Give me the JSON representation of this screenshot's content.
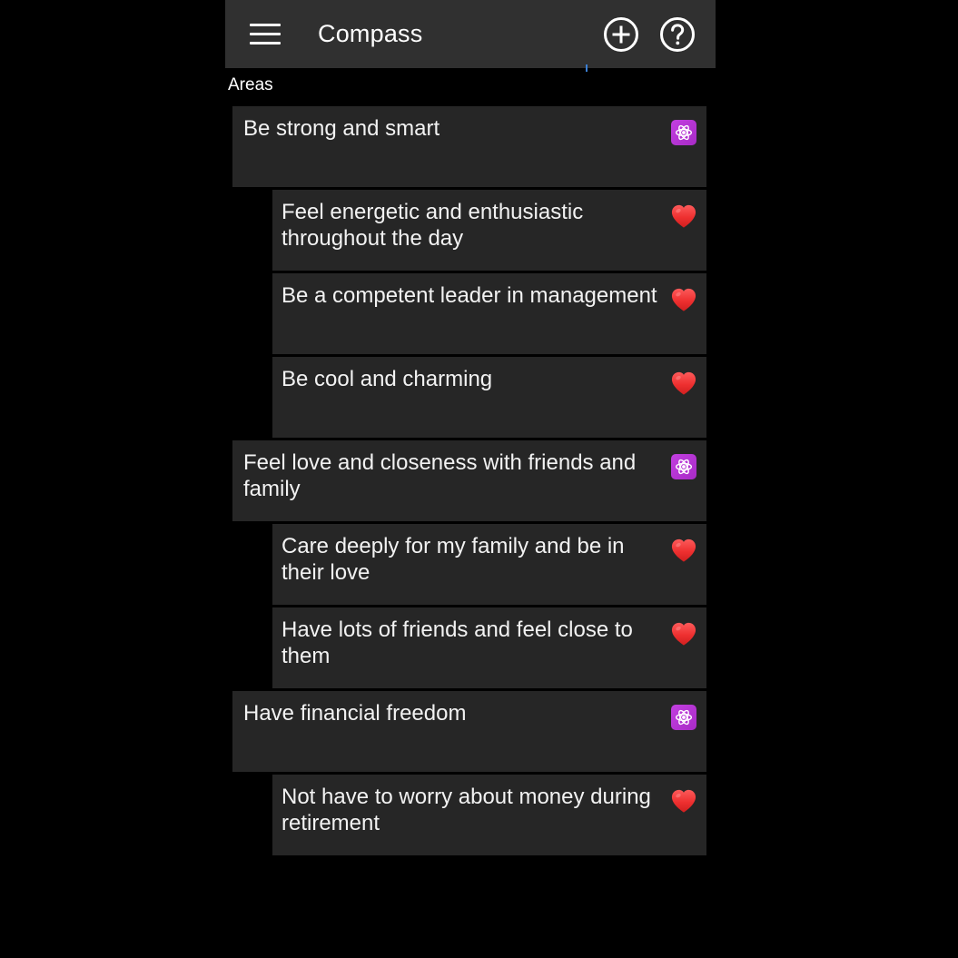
{
  "app": {
    "title": "Compass",
    "menu_icon": "hamburger-menu-icon",
    "add_icon": "add-circle-icon",
    "help_icon": "help-circle-icon"
  },
  "section": {
    "label": "Areas"
  },
  "colors": {
    "background": "#000000",
    "appbar": "#303030",
    "card": "#262626",
    "text": "#f2f2f2",
    "accent_purple": "#b833d6",
    "accent_red": "#ef3b3b",
    "tab_indicator": "#3b7fd4"
  },
  "list": [
    {
      "type": "area",
      "text": "Be strong and smart",
      "icon": "atom-icon"
    },
    {
      "type": "goal",
      "text": "Feel energetic and enthusiastic throughout the day",
      "icon": "heart-icon"
    },
    {
      "type": "goal",
      "text": "Be a competent leader in management",
      "icon": "heart-icon"
    },
    {
      "type": "goal",
      "text": "Be cool and charming",
      "icon": "heart-icon"
    },
    {
      "type": "area",
      "text": "Feel love and closeness with friends and family",
      "icon": "atom-icon"
    },
    {
      "type": "goal",
      "text": "Care deeply for my family and be in their love",
      "icon": "heart-icon"
    },
    {
      "type": "goal",
      "text": "Have lots of friends and feel close to them",
      "icon": "heart-icon"
    },
    {
      "type": "area",
      "text": "Have financial freedom",
      "icon": "atom-icon"
    },
    {
      "type": "goal",
      "text": "Not have to worry about money during retirement",
      "icon": "heart-icon"
    }
  ]
}
